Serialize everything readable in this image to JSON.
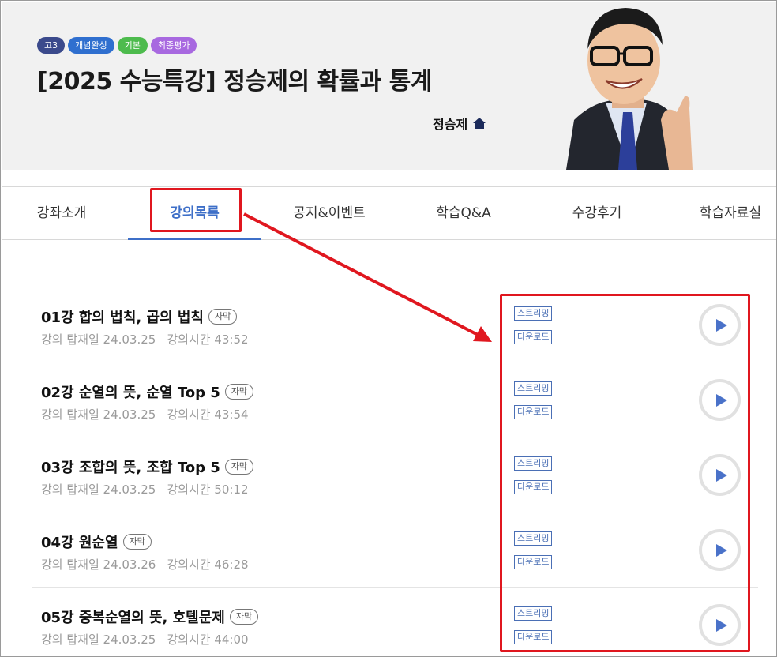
{
  "header": {
    "badges": [
      {
        "label": "고3",
        "color": "#3b4a8c"
      },
      {
        "label": "개념완성",
        "color": "#2f6fcf"
      },
      {
        "label": "기본",
        "color": "#4dbb4d"
      },
      {
        "label": "최종평가",
        "color": "#a869e0"
      }
    ],
    "course_title": "[2025 수능특강] 정승제의 확률과 통계",
    "teacher_name": "정승제"
  },
  "tabs": [
    {
      "label": "강좌소개",
      "active": false
    },
    {
      "label": "강의목록",
      "active": true
    },
    {
      "label": "공지&이벤트",
      "active": false
    },
    {
      "label": "학습Q&A",
      "active": false
    },
    {
      "label": "수강후기",
      "active": false
    },
    {
      "label": "학습자료실",
      "active": false
    }
  ],
  "lectures": [
    {
      "title": "01강 합의 법칙, 곱의 법칙",
      "badge": "자막",
      "upload": "강의 탑재일 24.03.25",
      "duration": "강의시간 43:52",
      "stream_label": "스트리밍",
      "download_label": "다운로드"
    },
    {
      "title": "02강 순열의 뜻, 순열 Top 5",
      "badge": "자막",
      "upload": "강의 탑재일 24.03.25",
      "duration": "강의시간 43:54",
      "stream_label": "스트리밍",
      "download_label": "다운로드"
    },
    {
      "title": "03강 조합의 뜻, 조합 Top 5",
      "badge": "자막",
      "upload": "강의 탑재일 24.03.25",
      "duration": "강의시간 50:12",
      "stream_label": "스트리밍",
      "download_label": "다운로드"
    },
    {
      "title": "04강 원순열",
      "badge": "자막",
      "upload": "강의 탑재일 24.03.26",
      "duration": "강의시간 46:28",
      "stream_label": "스트리밍",
      "download_label": "다운로드"
    },
    {
      "title": "05강 중복순열의 뜻, 호텔문제",
      "badge": "자막",
      "upload": "강의 탑재일 24.03.25",
      "duration": "강의시간 44:00",
      "stream_label": "스트리밍",
      "download_label": "다운로드"
    }
  ],
  "colors": {
    "accent": "#3e6fc8",
    "annotation": "#e0171f",
    "play_icon": "#4a72c9"
  }
}
